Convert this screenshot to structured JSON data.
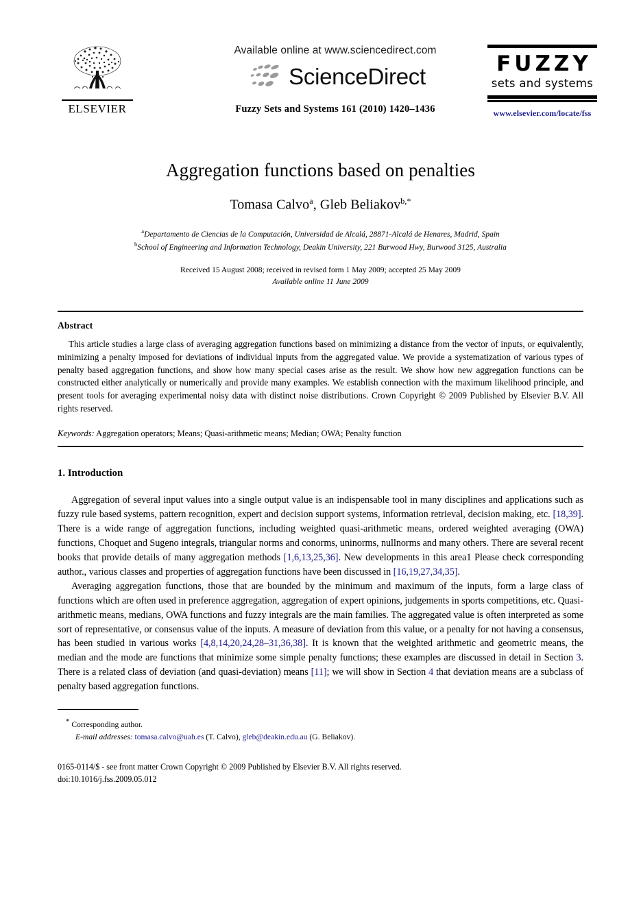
{
  "masthead": {
    "publisher_logo_text": "ELSEVIER",
    "available_online": "Available online at www.sciencedirect.com",
    "sciencedirect_wordmark": "ScienceDirect",
    "journal_reference": "Fuzzy Sets and Systems  161 (2010) 1420–1436",
    "journal_logo": {
      "title": "FUZZY",
      "subtitle": "sets and systems"
    },
    "journal_url": "www.elsevier.com/locate/fss"
  },
  "title": "Aggregation functions based on penalties",
  "authors": {
    "full": "Tomasa Calvo",
    "author1_name": "Tomasa Calvo",
    "author1_sup": "a",
    "separator": ", ",
    "author2_name": "Gleb Beliakov",
    "author2_sup": "b,*"
  },
  "affiliations": [
    {
      "sup": "a",
      "text": "Departamento de Ciencias de la Computación, Universidad de Alcalá, 28871-Alcalá de Henares, Madrid, Spain"
    },
    {
      "sup": "b",
      "text": "School of Engineering and Information Technology, Deakin University, 221 Burwood Hwy, Burwood 3125, Australia"
    }
  ],
  "history": {
    "received": "Received 15 August 2008; received in revised form 1 May 2009; accepted 25 May 2009",
    "available_online": "Available online 11 June 2009"
  },
  "abstract": {
    "heading": "Abstract",
    "body": "This article studies a large class of averaging aggregation functions based on minimizing a distance from the vector of inputs, or equivalently, minimizing a penalty imposed for deviations of individual inputs from the aggregated value. We provide a systematization of various types of penalty based aggregation functions, and show how many special cases arise as the result. We show how new aggregation functions can be constructed either analytically or numerically and provide many examples. We establish connection with the maximum likelihood principle, and present tools for averaging experimental noisy data with distinct noise distributions. Crown Copyright © 2009 Published by Elsevier B.V. All rights reserved."
  },
  "keywords": {
    "label": "Keywords:",
    "value": " Aggregation operators; Means; Quasi-arithmetic means; Median; OWA; Penalty function"
  },
  "section": {
    "heading": "1.  Introduction",
    "paragraph1": {
      "part1": "Aggregation of several input values into a single output value is an indispensable tool in many disciplines and applications such as fuzzy rule based systems, pattern recognition, expert and decision support systems, information retrieval, decision making, etc. ",
      "ref1": "[18,39]",
      "part2": ". There is a wide range of aggregation functions, including weighted quasi-arithmetic means, ordered weighted averaging (OWA) functions, Choquet and Sugeno integrals, triangular norms and conorms, uninorms, nullnorms and many others. There are several recent books that provide details of many aggregation methods ",
      "ref2": "[1,6,13,25,36]",
      "part3": ". New developments in this area1 Please check corresponding author., various classes and properties of aggregation functions have been discussed in ",
      "ref3": "[16,19,27,34,35]",
      "part4": "."
    },
    "paragraph2": {
      "part1": "Averaging aggregation functions, those that are bounded by the minimum and maximum of the inputs, form a large class of functions which are often used in preference aggregation, aggregation of expert opinions, judgements in sports competitions, etc. Quasi-arithmetic means, medians, OWA functions and fuzzy integrals are the main families. The aggregated value is often interpreted as some sort of representative, or consensus value of the inputs. A measure of deviation from this value, or a penalty for not having a consensus, has been studied in various works ",
      "ref1": "[4,8,14,20,24,28–31,36,38]",
      "part2": ". It is known that the weighted arithmetic and geometric means, the median and the mode are functions that minimize some simple penalty functions; these examples are discussed in detail in Section ",
      "ref2": "3",
      "part3": ". There is a related class of deviation (and quasi-deviation) means ",
      "ref3": "[11]",
      "part4": "; we will show in Section ",
      "ref4": "4",
      "part5": " that deviation means are a subclass of penalty based aggregation functions."
    }
  },
  "footnote": {
    "star": "*",
    "corresponding": " Corresponding author.",
    "email_label": "E-mail addresses:",
    "email1": "tomasa.calvo@uah.es",
    "email1_owner": " (T. Calvo), ",
    "email2": "gleb@deakin.edu.au",
    "email2_owner": " (G. Beliakov)."
  },
  "copyright": {
    "line1": "0165-0114/$ - see front matter Crown Copyright © 2009 Published by Elsevier B.V. All rights reserved.",
    "line2": "doi:10.1016/j.fss.2009.05.012"
  },
  "colors": {
    "link": "#1b1b8f",
    "text": "#000000",
    "background": "#ffffff",
    "sciencedirect_dots": "#9a9a9a"
  }
}
